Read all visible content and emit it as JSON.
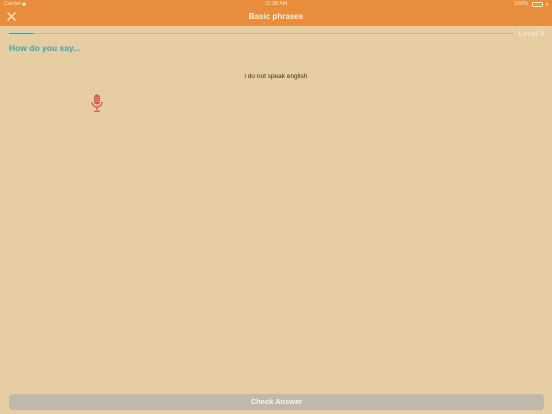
{
  "status_bar": {
    "carrier": "Carrier",
    "time": "11:38 AM",
    "battery": "100%"
  },
  "nav": {
    "title": "Basic phrases",
    "close_icon": "close-icon"
  },
  "progress": {
    "fraction": 0.05
  },
  "level": "Level 3",
  "exercise": {
    "prompt": "How do you say...",
    "phrase": "i do not speak english",
    "mic_icon": "microphone-icon"
  },
  "footer": {
    "check_label": "Check Answer"
  },
  "colors": {
    "header": "#e88d3c",
    "background": "#e6cda2",
    "accent": "#3aa4b8",
    "mic": "#d9534f",
    "button_disabled": "#bfb8ab"
  }
}
